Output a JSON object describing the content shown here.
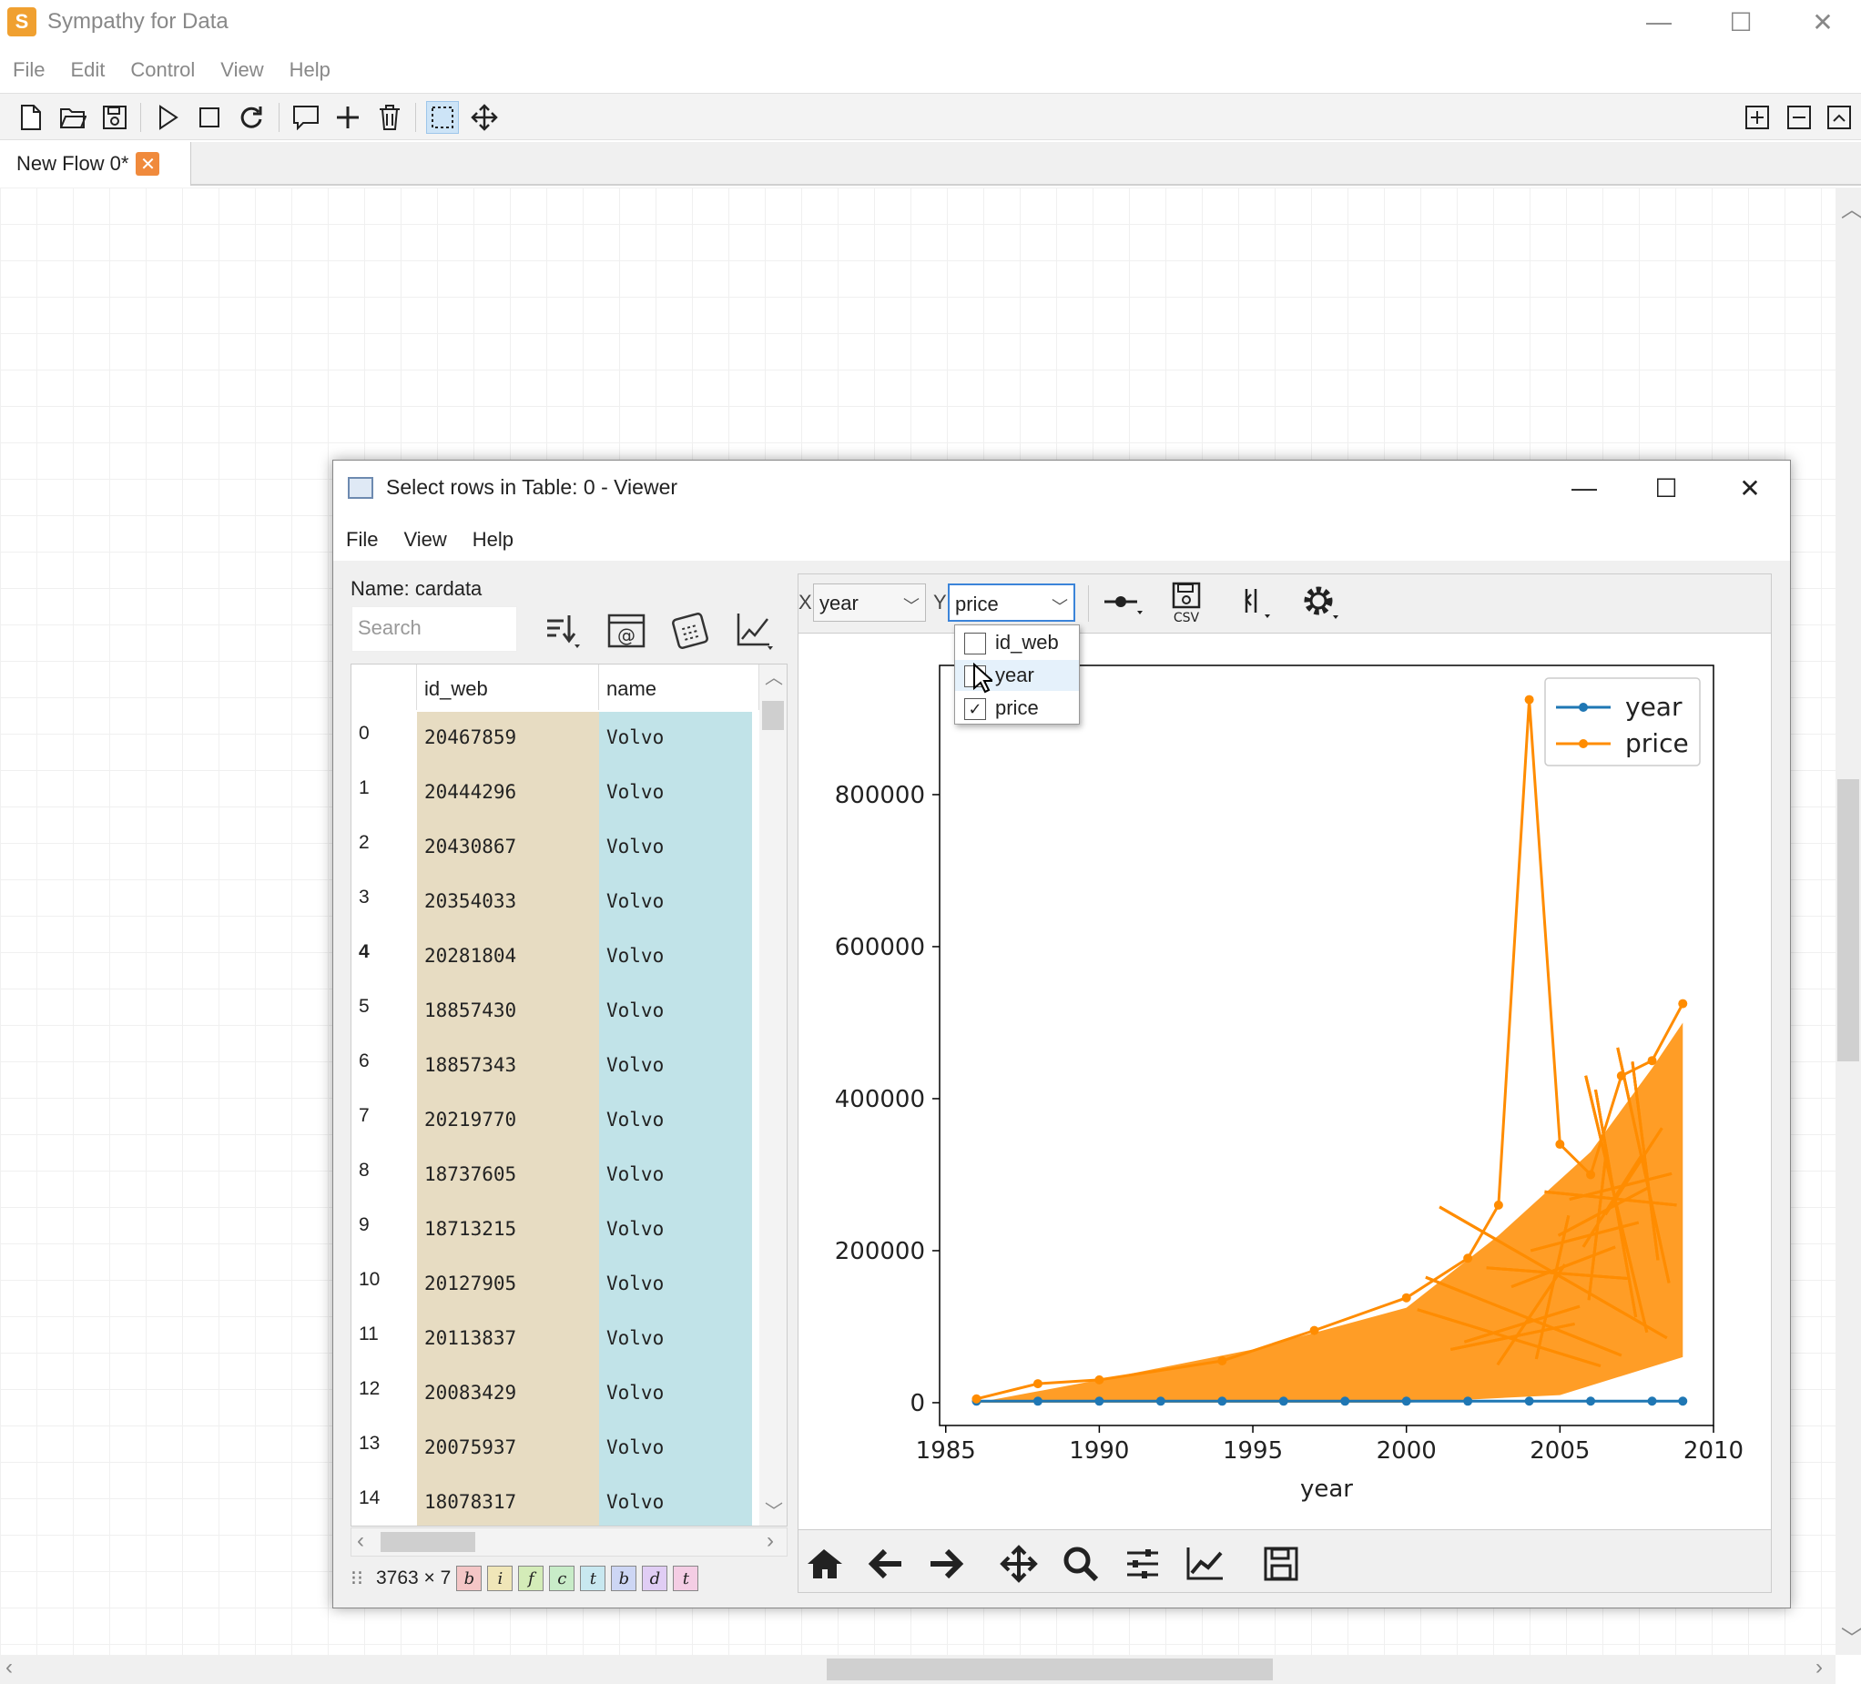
{
  "app": {
    "title": "Sympathy for Data",
    "logo_glyph": "S",
    "controls": {
      "minimize": "—",
      "maximize": "☐",
      "close": "✕"
    },
    "menus": [
      "File",
      "Edit",
      "Control",
      "View",
      "Help"
    ],
    "toolbar_icons": [
      "new-file-icon",
      "open-folder-icon",
      "save-icon",
      "play-icon",
      "stop-icon",
      "reload-icon",
      "comment-icon",
      "add-icon",
      "delete-icon",
      "select-rect-icon",
      "move-icon",
      "zoom-in-icon",
      "zoom-out-icon",
      "fit-icon"
    ],
    "tab": {
      "label": "New Flow 0*",
      "close": "✕"
    }
  },
  "viewer": {
    "title": "Select rows in Table: 0 - Viewer",
    "controls": {
      "minimize": "—",
      "maximize": "☐",
      "close": "✕"
    },
    "menus": [
      "File",
      "View",
      "Help"
    ],
    "name_label": "Name: cardata",
    "search_placeholder": "Search",
    "tool_icons": [
      "sort-icon",
      "email-icon",
      "calculator-icon",
      "plot-icon"
    ],
    "table": {
      "columns": [
        "id_web",
        "name"
      ],
      "rows": [
        {
          "index": "0",
          "id_web": "20467859",
          "name": "Volvo"
        },
        {
          "index": "1",
          "id_web": "20444296",
          "name": "Volvo"
        },
        {
          "index": "2",
          "id_web": "20430867",
          "name": "Volvo"
        },
        {
          "index": "3",
          "id_web": "20354033",
          "name": "Volvo"
        },
        {
          "index": "4",
          "id_web": "20281804",
          "name": "Volvo"
        },
        {
          "index": "5",
          "id_web": "18857430",
          "name": "Volvo"
        },
        {
          "index": "6",
          "id_web": "18857343",
          "name": "Volvo"
        },
        {
          "index": "7",
          "id_web": "20219770",
          "name": "Volvo"
        },
        {
          "index": "8",
          "id_web": "18737605",
          "name": "Volvo"
        },
        {
          "index": "9",
          "id_web": "18713215",
          "name": "Volvo"
        },
        {
          "index": "10",
          "id_web": "20127905",
          "name": "Volvo"
        },
        {
          "index": "11",
          "id_web": "20113837",
          "name": "Volvo"
        },
        {
          "index": "12",
          "id_web": "20083429",
          "name": "Volvo"
        },
        {
          "index": "13",
          "id_web": "20075937",
          "name": "Volvo"
        },
        {
          "index": "14",
          "id_web": "18078317",
          "name": "Volvo"
        }
      ]
    },
    "status": {
      "size": "3763 × 7",
      "type_chips": [
        {
          "letter": "b",
          "color": "#f4c6c6"
        },
        {
          "letter": "i",
          "color": "#f0e6b8"
        },
        {
          "letter": "f",
          "color": "#d4ecb8"
        },
        {
          "letter": "c",
          "color": "#c8ecc8"
        },
        {
          "letter": "t",
          "color": "#c8e8f0"
        },
        {
          "letter": "b",
          "color": "#cdd6f4"
        },
        {
          "letter": "d",
          "color": "#e0cdf4"
        },
        {
          "letter": "t",
          "color": "#f4cde4"
        }
      ]
    },
    "plot_toolbar": {
      "x_label": "X",
      "x_value": "year",
      "y_label": "Y",
      "y_value": "price",
      "icons": [
        "line-style-icon",
        "csv-save-icon",
        "marker-icon",
        "settings-icon"
      ],
      "csv_text": "CSV"
    },
    "y_dropdown": {
      "options": [
        {
          "label": "id_web",
          "checked": false,
          "highlighted": false
        },
        {
          "label": "year",
          "checked": false,
          "highlighted": true
        },
        {
          "label": "price",
          "checked": true,
          "highlighted": false
        }
      ]
    },
    "nav_icons": [
      "home-icon",
      "back-arrow-icon",
      "forward-arrow-icon",
      "pan-icon",
      "zoom-icon",
      "configure-icon",
      "edit-curves-icon",
      "save-figure-icon"
    ]
  },
  "chart_data": {
    "type": "line",
    "xlabel": "year",
    "ylabel": "",
    "xlim": [
      1984.8,
      2010
    ],
    "ylim": [
      -30000,
      970000
    ],
    "x_ticks": [
      "1985",
      "1990",
      "1995",
      "2000",
      "2005",
      "2010"
    ],
    "y_ticks": [
      "0",
      "200000",
      "400000",
      "600000",
      "800000"
    ],
    "legend_position": "top-right",
    "series": [
      {
        "name": "year",
        "color": "#1f77b4",
        "x": [
          1986,
          1988,
          1990,
          1992,
          1994,
          1996,
          1998,
          2000,
          2002,
          2004,
          2006,
          2008,
          2009
        ],
        "y": [
          1986,
          1988,
          1990,
          1992,
          1994,
          1996,
          1998,
          2000,
          2002,
          2004,
          2006,
          2008,
          2009
        ]
      },
      {
        "name": "price",
        "color": "#ff8c00",
        "x": [
          1986,
          1988,
          1990,
          1994,
          1997,
          2000,
          2002,
          2003,
          2004,
          2005,
          2006,
          2007,
          2008,
          2009
        ],
        "y": [
          5000,
          25000,
          30000,
          55000,
          95000,
          138000,
          190000,
          260000,
          925000,
          340000,
          300000,
          430000,
          450000,
          525000
        ]
      }
    ]
  }
}
